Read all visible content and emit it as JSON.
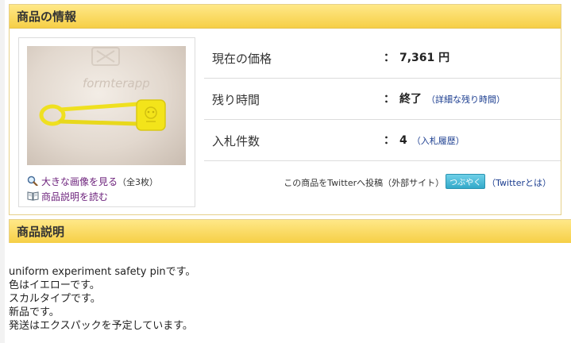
{
  "item_info": {
    "header": "商品の情報",
    "image_links": {
      "large_image_label": "大きな画像を見る",
      "large_image_count": "（全3枚）",
      "read_description_label": "商品説明を読む"
    },
    "rows": [
      {
        "label": "現在の価格",
        "value": "7,361 円",
        "link": ""
      },
      {
        "label": "残り時間",
        "value": "終了",
        "link": "（詳細な残り時間）"
      },
      {
        "label": "入札件数",
        "value": "4",
        "link": "（入札履歴）"
      }
    ],
    "twitter": {
      "text": "この商品をTwitterへ投稿（外部サイト）",
      "button_label": "つぶやく",
      "about_link": "（Twitterとは）"
    }
  },
  "description": {
    "header": "商品説明",
    "lines": [
      "uniform experiment safety pinです。",
      "色はイエローです。",
      "スカルタイプです。",
      "新品です。",
      "発送はエクスパックを予定しています。"
    ]
  },
  "colors": {
    "header_gradient_top": "#ffe888",
    "header_gradient_bottom": "#f6cf46",
    "link_blue": "#1a3c8f",
    "link_purple": "#6b1f7a",
    "pin_yellow": "#f3e41a"
  },
  "icons": {
    "magnifier": "magnifier-icon",
    "book": "book-icon"
  }
}
